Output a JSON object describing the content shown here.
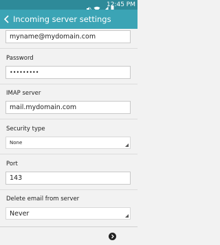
{
  "status_bar": {
    "time": "12:45 PM"
  },
  "header": {
    "title": "Incoming server settings"
  },
  "form": {
    "username_value": "myname@mydomain.com",
    "password_label": "Password",
    "password_value": "•••••••••",
    "imap_label": "IMAP server",
    "imap_value": "mail.mydomain.com",
    "security_label": "Security type",
    "security_value": "None",
    "port_label": "Port",
    "port_value": "143",
    "delete_label": "Delete email from server",
    "delete_value": "Never"
  },
  "icons": {
    "back": "chevron-left-icon",
    "next": "next-arrow-icon",
    "mute": "mute-icon",
    "wifi": "wifi-icon",
    "signal": "signal-icon",
    "battery": "battery-icon"
  },
  "colors": {
    "status_bar": "#2e8a99",
    "app_bar": "#3ba4b5",
    "background": "#f2f2f2"
  }
}
